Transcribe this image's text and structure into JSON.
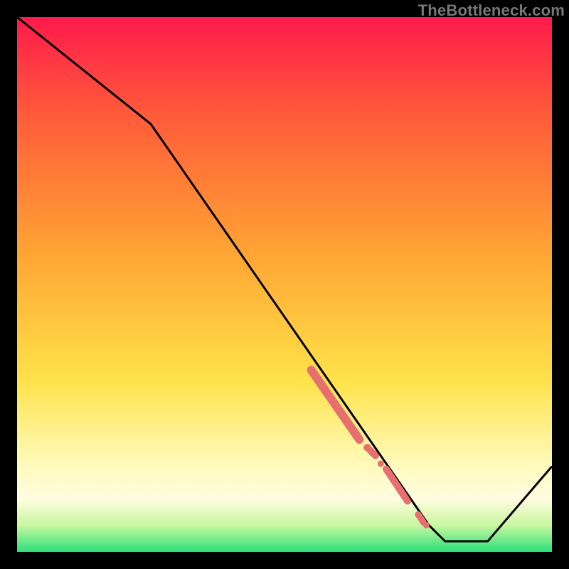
{
  "watermark": "TheBottleneck.com",
  "colors": {
    "black": "#000000",
    "line": "#000000",
    "marker": "#e86f6f",
    "gradient_top": "#ff1a4b",
    "gradient_mid_red": "#ff5a3a",
    "gradient_orange": "#ffa733",
    "gradient_yellow": "#ffe24a",
    "gradient_pale_yellow": "#fff8b0",
    "gradient_cream": "#fffde0",
    "gradient_lime": "#c9f7a0",
    "gradient_green": "#2be07a"
  },
  "chart_data": {
    "type": "line",
    "title": "",
    "xlabel": "",
    "ylabel": "",
    "xlim": [
      0,
      100
    ],
    "ylim": [
      0,
      100
    ],
    "grid": false,
    "line_points": [
      {
        "x": 0,
        "y": 100
      },
      {
        "x": 25,
        "y": 80
      },
      {
        "x": 77,
        "y": 5
      },
      {
        "x": 80,
        "y": 2
      },
      {
        "x": 88,
        "y": 2
      },
      {
        "x": 100,
        "y": 16
      }
    ],
    "highlight_segments": [
      {
        "x1": 55,
        "y1": 34,
        "x2": 64,
        "y2": 21,
        "width": 3.2
      },
      {
        "x1": 66,
        "y1": 19,
        "x2": 67,
        "y2": 18,
        "width": 2.6
      },
      {
        "x1": 69,
        "y1": 15.5,
        "x2": 73,
        "y2": 9.5,
        "width": 2.6
      },
      {
        "x1": 75,
        "y1": 7,
        "x2": 76,
        "y2": 5.5,
        "width": 2.4
      }
    ],
    "highlight_points": [
      {
        "x": 65.5,
        "y": 19.5,
        "r": 1.4
      },
      {
        "x": 68,
        "y": 16.5,
        "r": 1.2
      },
      {
        "x": 76.5,
        "y": 5,
        "r": 1.2
      }
    ]
  }
}
